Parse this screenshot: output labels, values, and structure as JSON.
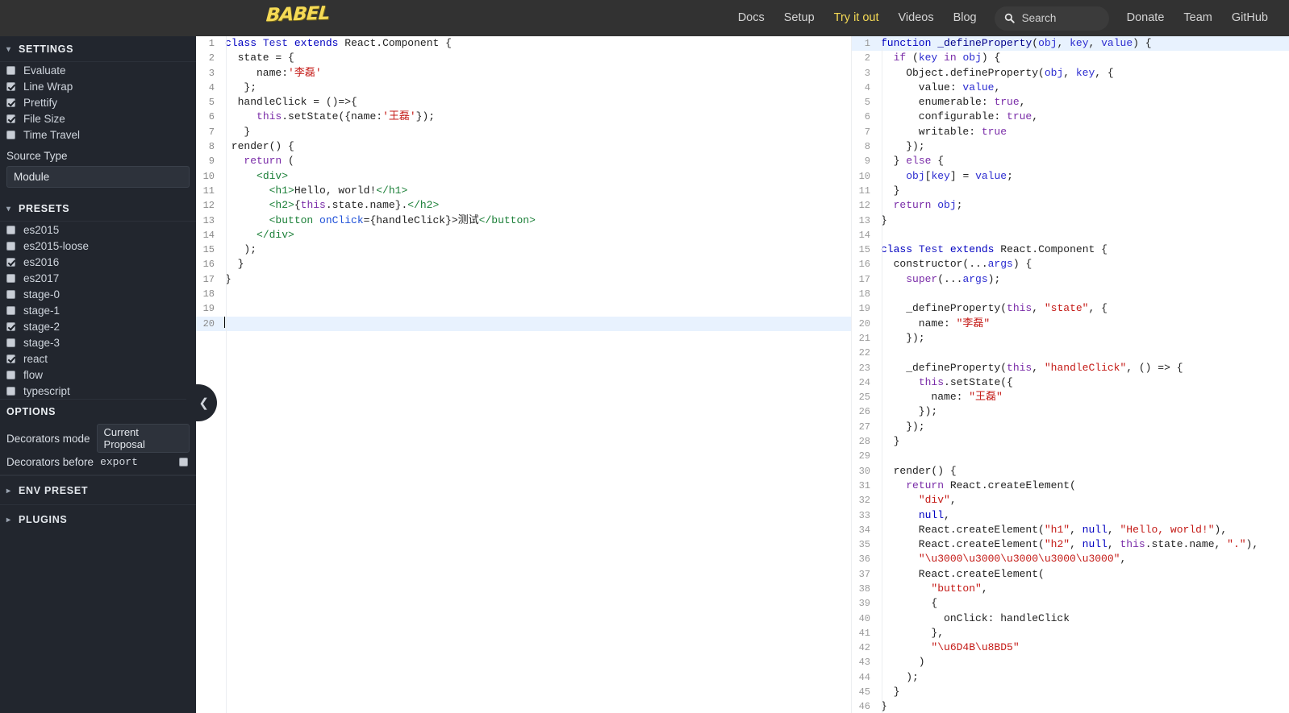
{
  "header": {
    "logo_text": "BABEL",
    "nav": [
      {
        "label": "Docs",
        "active": false
      },
      {
        "label": "Setup",
        "active": false
      },
      {
        "label": "Try it out",
        "active": true
      },
      {
        "label": "Videos",
        "active": false
      },
      {
        "label": "Blog",
        "active": false
      }
    ],
    "nav_right": [
      {
        "label": "Donate",
        "active": false
      },
      {
        "label": "Team",
        "active": false
      },
      {
        "label": "GitHub",
        "active": false
      }
    ],
    "search": {
      "icon": "search-icon",
      "placeholder": "Search",
      "value": ""
    },
    "bg_color": "#323232",
    "accent_color": "#f5da55"
  },
  "sidebar": {
    "bg_color": "#22262e",
    "settings": {
      "title": "SETTINGS",
      "expanded": true,
      "items": [
        {
          "label": "Evaluate",
          "checked": false
        },
        {
          "label": "Line Wrap",
          "checked": true
        },
        {
          "label": "Prettify",
          "checked": true
        },
        {
          "label": "File Size",
          "checked": true
        },
        {
          "label": "Time Travel",
          "checked": false
        }
      ],
      "source_type_label": "Source Type",
      "source_type_value": "Module"
    },
    "presets": {
      "title": "PRESETS",
      "expanded": true,
      "items": [
        {
          "label": "es2015",
          "checked": false
        },
        {
          "label": "es2015-loose",
          "checked": false
        },
        {
          "label": "es2016",
          "checked": true
        },
        {
          "label": "es2017",
          "checked": false
        },
        {
          "label": "stage-0",
          "checked": false
        },
        {
          "label": "stage-1",
          "checked": false
        },
        {
          "label": "stage-2",
          "checked": true
        },
        {
          "label": "stage-3",
          "checked": false
        },
        {
          "label": "react",
          "checked": true
        },
        {
          "label": "flow",
          "checked": false
        },
        {
          "label": "typescript",
          "checked": false
        }
      ]
    },
    "options": {
      "title": "OPTIONS",
      "decorators_mode_label": "Decorators mode",
      "decorators_mode_value": "Current Proposal",
      "decorators_before_label": "Decorators before",
      "decorators_before_value": "export",
      "decorators_before_checked": false
    },
    "env_preset": {
      "title": "ENV PRESET",
      "expanded": false
    },
    "plugins": {
      "title": "PLUGINS",
      "expanded": false
    },
    "collapse_handle_icon": "chevron-left-icon"
  },
  "editor_left": {
    "name": "source-editor",
    "cursor_line": 20,
    "total_lines": 20,
    "lines": [
      "class Test extends React.Component {",
      "  state = {",
      "     name:'李磊'",
      "   };",
      "  handleClick = ()=>{",
      "     this.setState({name:'王磊'});",
      "   }",
      " render() {",
      "   return (",
      "     <div>",
      "       <h1>Hello, world!</h1>",
      "       <h2>{this.state.name}.</h2>",
      "       <button onClick={handleClick}>测试</button>",
      "     </div>",
      "   );",
      "  }",
      "}",
      "",
      "",
      ""
    ]
  },
  "editor_right": {
    "name": "compiled-output",
    "highlighted_line": 1,
    "total_lines": 46,
    "lines": [
      "function _defineProperty(obj, key, value) {",
      "  if (key in obj) {",
      "    Object.defineProperty(obj, key, {",
      "      value: value,",
      "      enumerable: true,",
      "      configurable: true,",
      "      writable: true",
      "    });",
      "  } else {",
      "    obj[key] = value;",
      "  }",
      "  return obj;",
      "}",
      "",
      "class Test extends React.Component {",
      "  constructor(...args) {",
      "    super(...args);",
      "",
      "    _defineProperty(this, \"state\", {",
      "      name: \"李磊\"",
      "    });",
      "",
      "    _defineProperty(this, \"handleClick\", () => {",
      "      this.setState({",
      "        name: \"王磊\"",
      "      });",
      "    });",
      "  }",
      "",
      "  render() {",
      "    return React.createElement(",
      "      \"div\",",
      "      null,",
      "      React.createElement(\"h1\", null, \"Hello, world!\"),",
      "      React.createElement(\"h2\", null, this.state.name, \".\"),",
      "      \"\\u3000\\u3000\\u3000\\u3000\\u3000\",",
      "      React.createElement(",
      "        \"button\",",
      "        {",
      "          onClick: handleClick",
      "        },",
      "        \"\\u6D4B\\u8BD5\"",
      "      )",
      "    );",
      "  }",
      "}"
    ]
  }
}
